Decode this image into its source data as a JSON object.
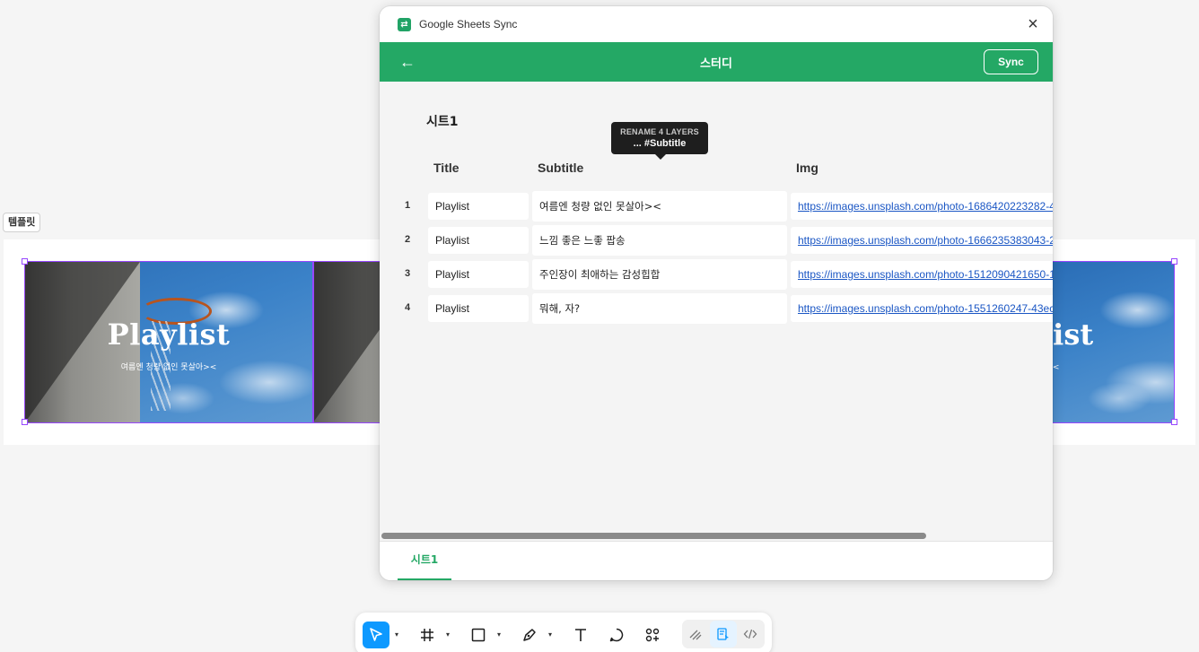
{
  "canvas": {
    "frame_label": "템플릿",
    "card": {
      "title": "Playlist",
      "subtitle": "여름엔 청량 없인 못살아><",
      "partial_title": "list"
    }
  },
  "plugin": {
    "app_title": "Google Sheets Sync",
    "header_title": "스터디",
    "sync_label": "Sync",
    "sheet_name": "시트1",
    "tooltip": {
      "line1": "RENAME 4 LAYERS",
      "line2": "... #Subtitle"
    },
    "columns": [
      "Title",
      "Subtitle",
      "Img"
    ],
    "rows": [
      {
        "num": "1",
        "title": "Playlist",
        "subtitle": "여름엔 청량 없인 못살아><",
        "img": "https://images.unsplash.com/photo-1686420223282-4"
      },
      {
        "num": "2",
        "title": "Playlist",
        "subtitle": "느낌 좋은 느좋 팝송",
        "img": "https://images.unsplash.com/photo-1666235383043-2"
      },
      {
        "num": "3",
        "title": "Playlist",
        "subtitle": "주인장이 최애하는 감성힙합",
        "img": "https://images.unsplash.com/photo-1512090421650-1"
      },
      {
        "num": "4",
        "title": "Playlist",
        "subtitle": "뭐해, 자?",
        "img": "https://images.unsplash.com/photo-1551260247-43ec"
      }
    ],
    "tab_label": "시트1"
  },
  "colors": {
    "brand_green": "#24a865",
    "selection": "#9747ff",
    "tool_active": "#0d99ff",
    "link": "#1a56c4"
  },
  "toolbar": {
    "tools": [
      "move-icon",
      "frame-icon",
      "rectangle-icon",
      "pen-icon",
      "text-icon",
      "comment-icon",
      "actions-icon"
    ],
    "mode_tools": [
      "draw-mode-icon",
      "design-mode-icon",
      "dev-mode-icon"
    ]
  }
}
